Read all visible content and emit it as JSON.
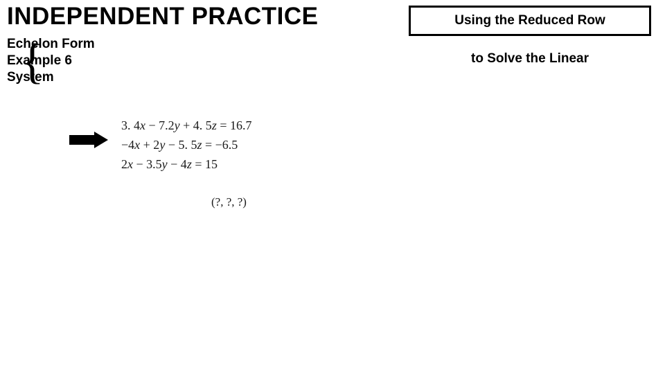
{
  "title": "INDEPENDENT PRACTICE",
  "subleft": {
    "l1": "Echelon Form",
    "l2": "Example 6",
    "l3": "System"
  },
  "topbox": "Using the Reduced Row",
  "rightline": "to Solve the Linear",
  "equations": {
    "e1": "3. 4x − 7. 2y + 4. 5z = 16. 7",
    "e2": "−4x + 2y − 5. 5z = −6. 5",
    "e3": "2x − 3. 5y − 4z = 15"
  },
  "answer": "(?, ?, ?)"
}
